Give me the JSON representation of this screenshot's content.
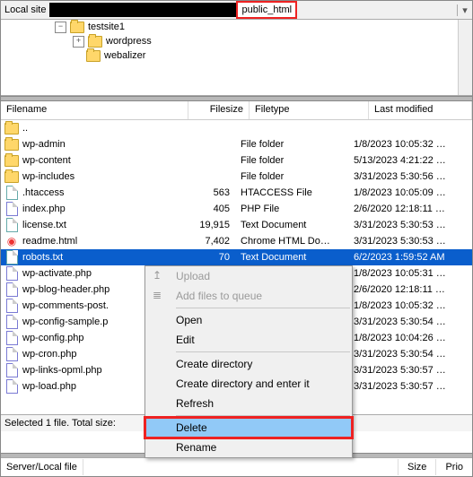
{
  "pathbar": {
    "label": "Local site",
    "redacted": true,
    "highlight_value": "public_html"
  },
  "tree": {
    "items": [
      {
        "label": "testsite1",
        "level": 1,
        "expand": "−"
      },
      {
        "label": "wordpress",
        "level": 2,
        "expand": "+"
      },
      {
        "label": "webalizer",
        "level": 2,
        "expand": ""
      }
    ]
  },
  "columns": {
    "name": "Filename",
    "size": "Filesize",
    "type": "Filetype",
    "modified": "Last modified"
  },
  "rows": [
    {
      "kind": "up",
      "name": "..",
      "size": "",
      "type": "",
      "mod": ""
    },
    {
      "kind": "folder",
      "name": "wp-admin",
      "size": "",
      "type": "File folder",
      "mod": "1/8/2023 10:05:32 …"
    },
    {
      "kind": "folder",
      "name": "wp-content",
      "size": "",
      "type": "File folder",
      "mod": "5/13/2023 4:21:22 …"
    },
    {
      "kind": "folder",
      "name": "wp-includes",
      "size": "",
      "type": "File folder",
      "mod": "3/31/2023 5:30:56 …"
    },
    {
      "kind": "file",
      "icon": "txt",
      "name": ".htaccess",
      "size": "563",
      "type": "HTACCESS File",
      "mod": "1/8/2023 10:05:09 …"
    },
    {
      "kind": "file",
      "icon": "php",
      "name": "index.php",
      "size": "405",
      "type": "PHP File",
      "mod": "2/6/2020 12:18:11 …"
    },
    {
      "kind": "file",
      "icon": "txt",
      "name": "license.txt",
      "size": "19,915",
      "type": "Text Document",
      "mod": "3/31/2023 5:30:53 …"
    },
    {
      "kind": "file",
      "icon": "chrome",
      "name": "readme.html",
      "size": "7,402",
      "type": "Chrome HTML Do…",
      "mod": "3/31/2023 5:30:53 …"
    },
    {
      "kind": "file",
      "icon": "txt",
      "name": "robots.txt",
      "size": "70",
      "type": "Text Document",
      "mod": "6/2/2023 1:59:52 AM",
      "selected": true
    },
    {
      "kind": "file",
      "icon": "php",
      "name": "wp-activate.php",
      "size": "",
      "type": "",
      "mod": "1/8/2023 10:05:31 …"
    },
    {
      "kind": "file",
      "icon": "php",
      "name": "wp-blog-header.php",
      "size": "",
      "type": "",
      "mod": "2/6/2020 12:18:11 …"
    },
    {
      "kind": "file",
      "icon": "php",
      "name": "wp-comments-post.",
      "size": "",
      "type": "",
      "mod": "1/8/2023 10:05:32 …"
    },
    {
      "kind": "file",
      "icon": "php",
      "name": "wp-config-sample.p",
      "size": "",
      "type": "",
      "mod": "3/31/2023 5:30:54 …"
    },
    {
      "kind": "file",
      "icon": "php",
      "name": "wp-config.php",
      "size": "",
      "type": "",
      "mod": "1/8/2023 10:04:26 …"
    },
    {
      "kind": "file",
      "icon": "php",
      "name": "wp-cron.php",
      "size": "",
      "type": "",
      "mod": "3/31/2023 5:30:54 …"
    },
    {
      "kind": "file",
      "icon": "php",
      "name": "wp-links-opml.php",
      "size": "",
      "type": "",
      "mod": "3/31/2023 5:30:57 …"
    },
    {
      "kind": "file",
      "icon": "php",
      "name": "wp-load.php",
      "size": "",
      "type": "",
      "mod": "3/31/2023 5:30:57 …"
    }
  ],
  "status": "Selected 1 file. Total size:",
  "bottom": {
    "left": "Server/Local file",
    "size": "Size",
    "prio": "Prio"
  },
  "context_menu": {
    "items": [
      {
        "label": "Upload",
        "disabled": true,
        "icon": "upload"
      },
      {
        "label": "Add files to queue",
        "disabled": true,
        "icon": "queue"
      },
      {
        "sep": true
      },
      {
        "label": "Open"
      },
      {
        "label": "Edit"
      },
      {
        "sep": true
      },
      {
        "label": "Create directory"
      },
      {
        "label": "Create directory and enter it"
      },
      {
        "label": "Refresh"
      },
      {
        "sep": true
      },
      {
        "label": "Delete",
        "highlight": true,
        "framed": true
      },
      {
        "label": "Rename"
      }
    ]
  }
}
